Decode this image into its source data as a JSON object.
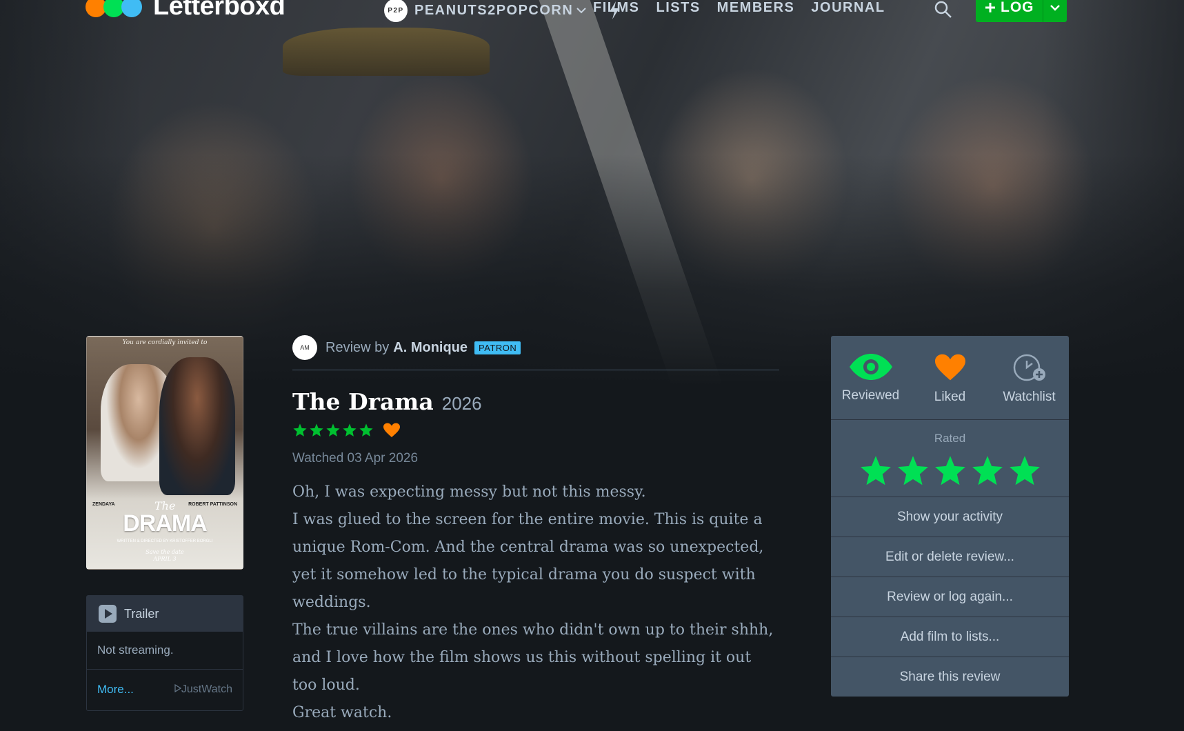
{
  "brand": {
    "name": "Letterboxd",
    "dot_colors": [
      "#ff8000",
      "#00e054",
      "#40bcf4"
    ]
  },
  "nav": {
    "username": "PEANUTS2POPCORN",
    "links": [
      "FILMS",
      "LISTS",
      "MEMBERS",
      "JOURNAL"
    ],
    "log_label": "LOG"
  },
  "poster": {
    "tagline": "You are cordially invited to",
    "actor_left": "ZENDAYA",
    "actor_right": "ROBERT PATTINSON",
    "title_the": "The",
    "title_main": "DRAMA",
    "credit": "WRITTEN & DIRECTED BY KRISTOFFER BORGLI",
    "save_date": "Save the date",
    "release": "APRIL 3"
  },
  "trailer": {
    "label": "Trailer",
    "streaming": "Not streaming.",
    "more": "More...",
    "provider": "JustWatch"
  },
  "review": {
    "byline_prefix": "Review by",
    "author": "A. Monique",
    "badge": "PATRON",
    "film_title": "The Drama",
    "year": "2026",
    "stars": 5,
    "liked": true,
    "watched": "Watched 03 Apr 2026",
    "paragraphs": [
      "Oh, I was expecting messy but not this messy.",
      "I was glued to the screen for the entire movie. This is quite a unique Rom-Com. And the central drama was so unexpected, yet it somehow led to the typical drama you do suspect with weddings.",
      "The true villains are the ones who didn't own up to their shhh, and I love how the film shows us this without spelling it out too loud.",
      "Great watch."
    ]
  },
  "sidebar": {
    "actions": [
      {
        "label": "Reviewed",
        "icon": "eye-icon",
        "color": "#00e054"
      },
      {
        "label": "Liked",
        "icon": "heart-icon",
        "color": "#ff8000"
      },
      {
        "label": "Watchlist",
        "icon": "watchlist-clock-icon",
        "color": "#9ab"
      }
    ],
    "rated_label": "Rated",
    "rating": 5,
    "star_color": "#00e054",
    "menu": [
      "Show your activity",
      "Edit or delete review...",
      "Review or log again...",
      "Add film to lists...",
      "Share this review"
    ]
  }
}
